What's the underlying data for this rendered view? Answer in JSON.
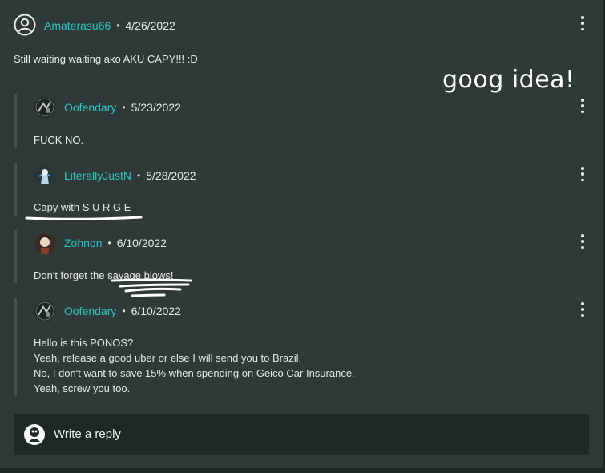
{
  "top_comment": {
    "username": "Amaterasu66",
    "date": "4/26/2022",
    "text": "Still waiting waiting ako AKU CAPY!!! :D"
  },
  "annotation": "goog idea!",
  "replies": [
    {
      "username": "Oofendary",
      "date": "5/23/2022",
      "lines": [
        "FUCK NO."
      ]
    },
    {
      "username": "LiterallyJustN",
      "date": "5/28/2022",
      "lines": [
        "Capy with S U R G E"
      ]
    },
    {
      "username": "Zohnon",
      "date": "6/10/2022",
      "lines": [
        "Don't forget the savage blows!"
      ]
    },
    {
      "username": "Oofendary",
      "date": "6/10/2022",
      "lines": [
        "Hello is this PONOS?",
        "Yeah, release a good uber or else I will send you to Brazil.",
        "No, I don't want to save 15% when spending on Geico Car Insurance.",
        "Yeah, screw you too."
      ]
    }
  ],
  "separator": "•",
  "reply_box": {
    "placeholder": "Write a reply"
  },
  "icons": {
    "user": "user-circle-icon",
    "more": "more-vertical-icon"
  },
  "colors": {
    "background": "#2f3a38",
    "username": "#2fc3c1",
    "reply_box": "#1e2826"
  }
}
